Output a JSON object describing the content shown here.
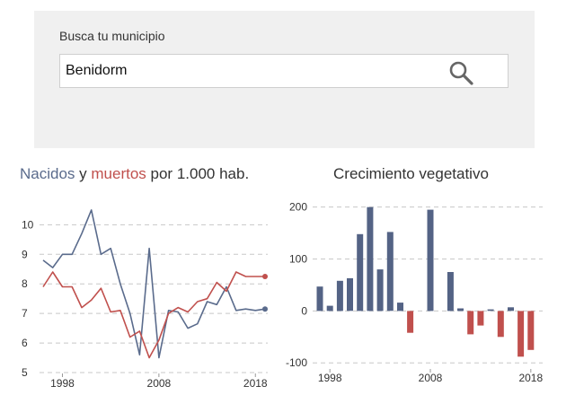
{
  "search": {
    "label": "Busca tu municipio",
    "value": "Benidorm"
  },
  "left_title": {
    "part1": "Nacidos",
    "part2": " y ",
    "part3": "muertos",
    "part4": " por 1.000 hab."
  },
  "right_title": "Crecimiento vegetativo",
  "colors": {
    "births": "#5a6b8c",
    "deaths": "#c0504d",
    "positive_bar": "#546385",
    "negative_bar": "#c0504d",
    "grid": "#c8c8c8",
    "panel": "#f0f0f0"
  },
  "chart_data": [
    {
      "type": "line",
      "title": "Nacidos y muertos por 1.000 hab.",
      "x": [
        1996,
        1997,
        1998,
        1999,
        2000,
        2001,
        2002,
        2003,
        2004,
        2005,
        2006,
        2007,
        2008,
        2009,
        2010,
        2011,
        2012,
        2013,
        2014,
        2015,
        2016,
        2017,
        2018,
        2019
      ],
      "series": [
        {
          "name": "Nacidos",
          "values": [
            8.8,
            8.55,
            9.0,
            9.0,
            9.7,
            10.5,
            9.0,
            9.2,
            8.0,
            7.0,
            5.6,
            9.2,
            5.5,
            7.1,
            7.05,
            6.5,
            6.65,
            7.4,
            7.3,
            7.9,
            7.1,
            7.15,
            7.1,
            7.15
          ],
          "end_marker": true
        },
        {
          "name": "muertos",
          "values": [
            7.9,
            8.4,
            7.9,
            7.9,
            7.2,
            7.45,
            7.85,
            7.05,
            7.1,
            6.2,
            6.4,
            5.5,
            6.1,
            7.0,
            7.2,
            7.05,
            7.4,
            7.5,
            8.05,
            7.75,
            8.4,
            8.25,
            8.25,
            8.25
          ],
          "end_marker": true
        }
      ],
      "xticks": [
        "1998",
        "2008",
        "2018"
      ],
      "yticks": [
        "5",
        "6",
        "7",
        "8",
        "9",
        "10"
      ],
      "ylim": [
        5,
        10.8
      ],
      "grid": true
    },
    {
      "type": "bar",
      "title": "Crecimiento vegetativo",
      "x": [
        1997,
        1998,
        1999,
        2000,
        2001,
        2002,
        2003,
        2004,
        2005,
        2006,
        2007,
        2008,
        2009,
        2010,
        2011,
        2012,
        2013,
        2014,
        2015,
        2016,
        2017,
        2018,
        2019
      ],
      "values": [
        47,
        10,
        58,
        63,
        148,
        200,
        80,
        152,
        16,
        -42,
        0,
        195,
        0,
        75,
        5,
        -45,
        -28,
        3,
        -50,
        7,
        -88,
        -75,
        0
      ],
      "xticks": [
        "1998",
        "2008",
        "2018"
      ],
      "yticks": [
        "-100",
        "0",
        "100",
        "200"
      ],
      "ylim": [
        -110,
        215
      ],
      "grid": true
    }
  ]
}
